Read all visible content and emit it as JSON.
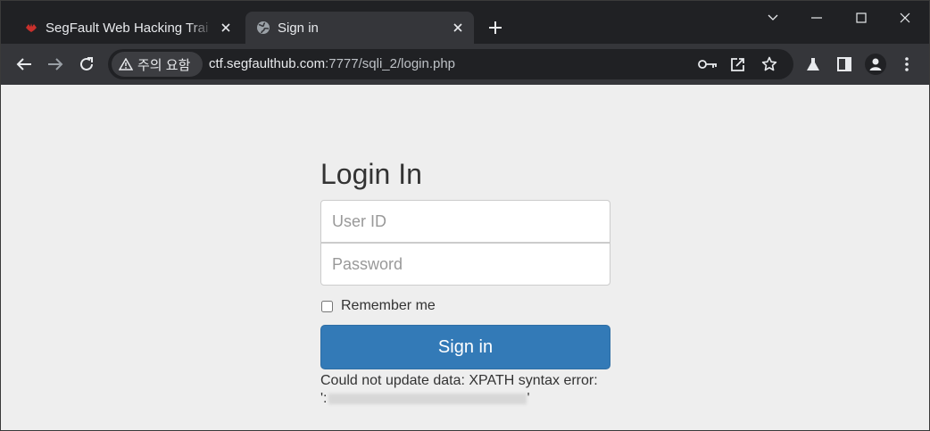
{
  "browser": {
    "tabs": [
      {
        "title": "SegFault Web Hacking Trai",
        "favicon": "segfault-favicon",
        "active": false
      },
      {
        "title": "Sign in",
        "favicon": "globe-icon",
        "active": true
      }
    ],
    "security_label": "주의 요함",
    "url_host": "ctf.segfaulthub.com",
    "url_rest": ":7777/sqli_2/login.php"
  },
  "page": {
    "heading": "Login In",
    "user_placeholder": "User ID",
    "password_placeholder": "Password",
    "remember_label": "Remember me",
    "signin_label": "Sign in",
    "error_line1": "Could not update data: XPATH syntax error:",
    "error_quote_open": "':",
    "error_quote_close": "'"
  },
  "colors": {
    "button_primary": "#337ab7",
    "page_background": "#eeeeee",
    "browser_frame": "#202124"
  }
}
